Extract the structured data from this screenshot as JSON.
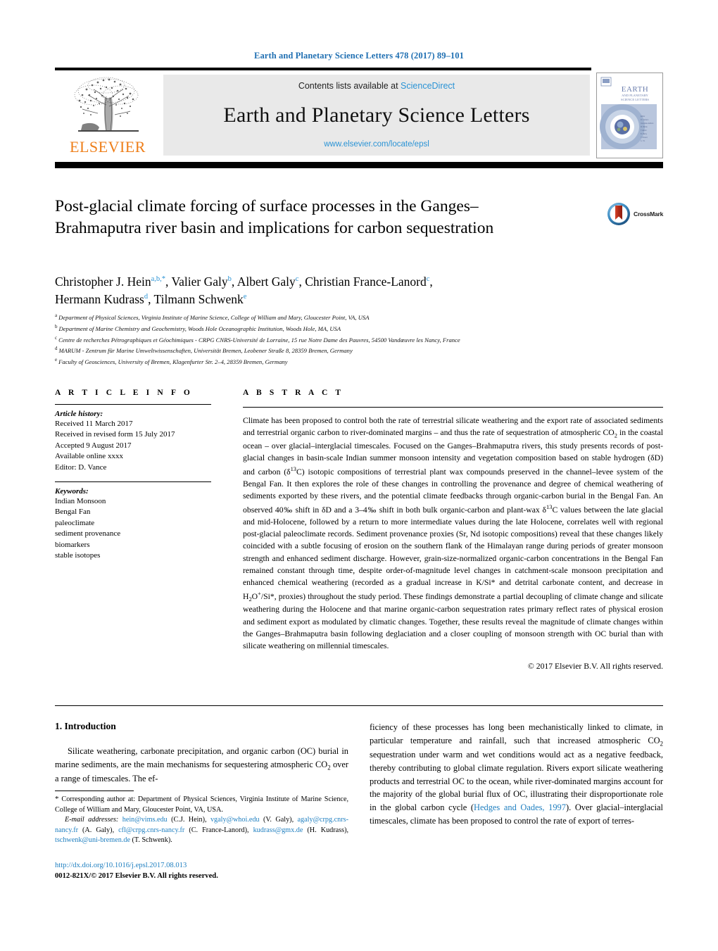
{
  "running_head": "Earth and Planetary Science Letters 478 (2017) 89–101",
  "masthead": {
    "publisher_name": "ELSEVIER",
    "contents_prefix": "Contents lists available at ",
    "contents_link": "ScienceDirect",
    "journal_title": "Earth and Planetary Science Letters",
    "journal_url": "www.elsevier.com/locate/epsl",
    "cover_title_line1": "EARTH",
    "cover_title_line2": "AND PLANETARY",
    "cover_title_line3": "SCIENCE LETTERS"
  },
  "article": {
    "title": "Post-glacial climate forcing of surface processes in the Ganges–Brahmaputra river basin and implications for carbon sequestration",
    "crossmark_label": "CrossMark",
    "authors_line1_parts": [
      {
        "name": "Christopher J. Hein",
        "marks": "a,b,*"
      },
      {
        "name": "Valier Galy",
        "marks": "b"
      },
      {
        "name": "Albert Galy",
        "marks": "c"
      },
      {
        "name": "Christian France-Lanord",
        "marks": "c"
      }
    ],
    "authors_line2_parts": [
      {
        "name": "Hermann Kudrass",
        "marks": "d"
      },
      {
        "name": "Tilmann Schwenk",
        "marks": "e"
      }
    ],
    "affiliations": [
      {
        "mark": "a",
        "text": "Department of Physical Sciences, Virginia Institute of Marine Science, College of William and Mary, Gloucester Point, VA, USA"
      },
      {
        "mark": "b",
        "text": "Department of Marine Chemistry and Geochemistry, Woods Hole Oceanographic Institution, Woods Hole, MA, USA"
      },
      {
        "mark": "c",
        "text": "Centre de recherches Pétrographiques et Géochimiques - CRPG CNRS-Université de Lorraine, 15 rue Notre Dame des Pauvres, 54500 Vandœuvre les Nancy, France"
      },
      {
        "mark": "d",
        "text": "MARUM - Zentrum für Marine Umweltwissenschaften, Universität Bremen, Leobener Straße 8, 28359 Bremen, Germany"
      },
      {
        "mark": "e",
        "text": "Faculty of Geosciences, University of Bremen, Klagenfurter Str. 2–4, 28359 Bremen, Germany"
      }
    ]
  },
  "article_info": {
    "section_label": "A R T I C L E    I N F O",
    "history_head": "Article history:",
    "history_lines": [
      "Received 11 March 2017",
      "Received in revised form 15 July 2017",
      "Accepted 9 August 2017",
      "Available online xxxx",
      "Editor: D. Vance"
    ],
    "keywords_head": "Keywords:",
    "keywords": [
      "Indian Monsoon",
      "Bengal Fan",
      "paleoclimate",
      "sediment provenance",
      "biomarkers",
      "stable isotopes"
    ]
  },
  "abstract": {
    "section_label": "A B S T R A C T",
    "text": "Climate has been proposed to control both the rate of terrestrial silicate weathering and the export rate of associated sediments and terrestrial organic carbon to river-dominated margins – and thus the rate of sequestration of atmospheric CO2 in the coastal ocean – over glacial–interglacial timescales. Focused on the Ganges–Brahmaputra rivers, this study presents records of post-glacial changes in basin-scale Indian summer monsoon intensity and vegetation composition based on stable hydrogen (δD) and carbon (δ13C) isotopic compositions of terrestrial plant wax compounds preserved in the channel–levee system of the Bengal Fan. It then explores the role of these changes in controlling the provenance and degree of chemical weathering of sediments exported by these rivers, and the potential climate feedbacks through organic-carbon burial in the Bengal Fan. An observed 40‰ shift in δD and a 3–4‰ shift in both bulk organic-carbon and plant-wax δ13C values between the late glacial and mid-Holocene, followed by a return to more intermediate values during the late Holocene, correlates well with regional post-glacial paleoclimate records. Sediment provenance proxies (Sr, Nd isotopic compositions) reveal that these changes likely coincided with a subtle focusing of erosion on the southern flank of the Himalayan range during periods of greater monsoon strength and enhanced sediment discharge. However, grain-size-normalized organic-carbon concentrations in the Bengal Fan remained constant through time, despite order-of-magnitude level changes in catchment-scale monsoon precipitation and enhanced chemical weathering (recorded as a gradual increase in K/Si* and detrital carbonate content, and decrease in H2O+/Si*, proxies) throughout the study period. These findings demonstrate a partial decoupling of climate change and silicate weathering during the Holocene and that marine organic-carbon sequestration rates primary reflect rates of physical erosion and sediment export as modulated by climatic changes. Together, these results reveal the magnitude of climate changes within the Ganges–Brahmaputra basin following deglaciation and a closer coupling of monsoon strength with OC burial than with silicate weathering on millennial timescales.",
    "copyright": "© 2017 Elsevier B.V. All rights reserved."
  },
  "body": {
    "section_heading": "1. Introduction",
    "left_paragraph": "Silicate weathering, carbonate precipitation, and organic carbon (OC) burial in marine sediments, are the main mechanisms for sequestering atmospheric CO2 over a range of timescales. The ef-",
    "right_paragraph_pre": "ficiency of these processes has long been mechanistically linked to climate, in particular temperature and rainfall, such that increased atmospheric CO2 sequestration under warm and wet conditions would act as a negative feedback, thereby contributing to global climate regulation. Rivers export silicate weathering products and terrestrial OC to the ocean, while river-dominated margins account for the majority of the global burial flux of OC, illustrating their disproportionate role in the global carbon cycle (",
    "right_citation": "Hedges and Oades, 1997",
    "right_paragraph_post": "). Over glacial–interglacial timescales, climate has been proposed to control the rate of export of terres-"
  },
  "footnotes": {
    "corresponding": "Corresponding author at: Department of Physical Sciences, Virginia Institute of Marine Science, College of William and Mary, Gloucester Point, VA, USA.",
    "email_label": "E-mail addresses:",
    "emails": [
      {
        "address": "hein@vims.edu",
        "owner": "(C.J. Hein)"
      },
      {
        "address": "vgaly@whoi.edu",
        "owner": "(V. Galy)"
      },
      {
        "address": "agaly@crpg.cnrs-nancy.fr",
        "owner": "(A. Galy)"
      },
      {
        "address": "cfl@crpg.cnrs-nancy.fr",
        "owner": "(C. France-Lanord)"
      },
      {
        "address": "kudrass@gmx.de",
        "owner": "(H. Kudrass)"
      },
      {
        "address": "tschwenk@uni-bremen.de",
        "owner": "(T. Schwenk)"
      }
    ],
    "doi": "http://dx.doi.org/10.1016/j.epsl.2017.08.013",
    "issn_line": "0012-821X/© 2017 Elsevier B.V. All rights reserved."
  },
  "colors": {
    "link_blue": "#1f7fc0",
    "sciencedirect_blue": "#2a93d5",
    "elsevier_orange": "#ee7f1a",
    "masthead_grey": "#e9e9e9"
  }
}
